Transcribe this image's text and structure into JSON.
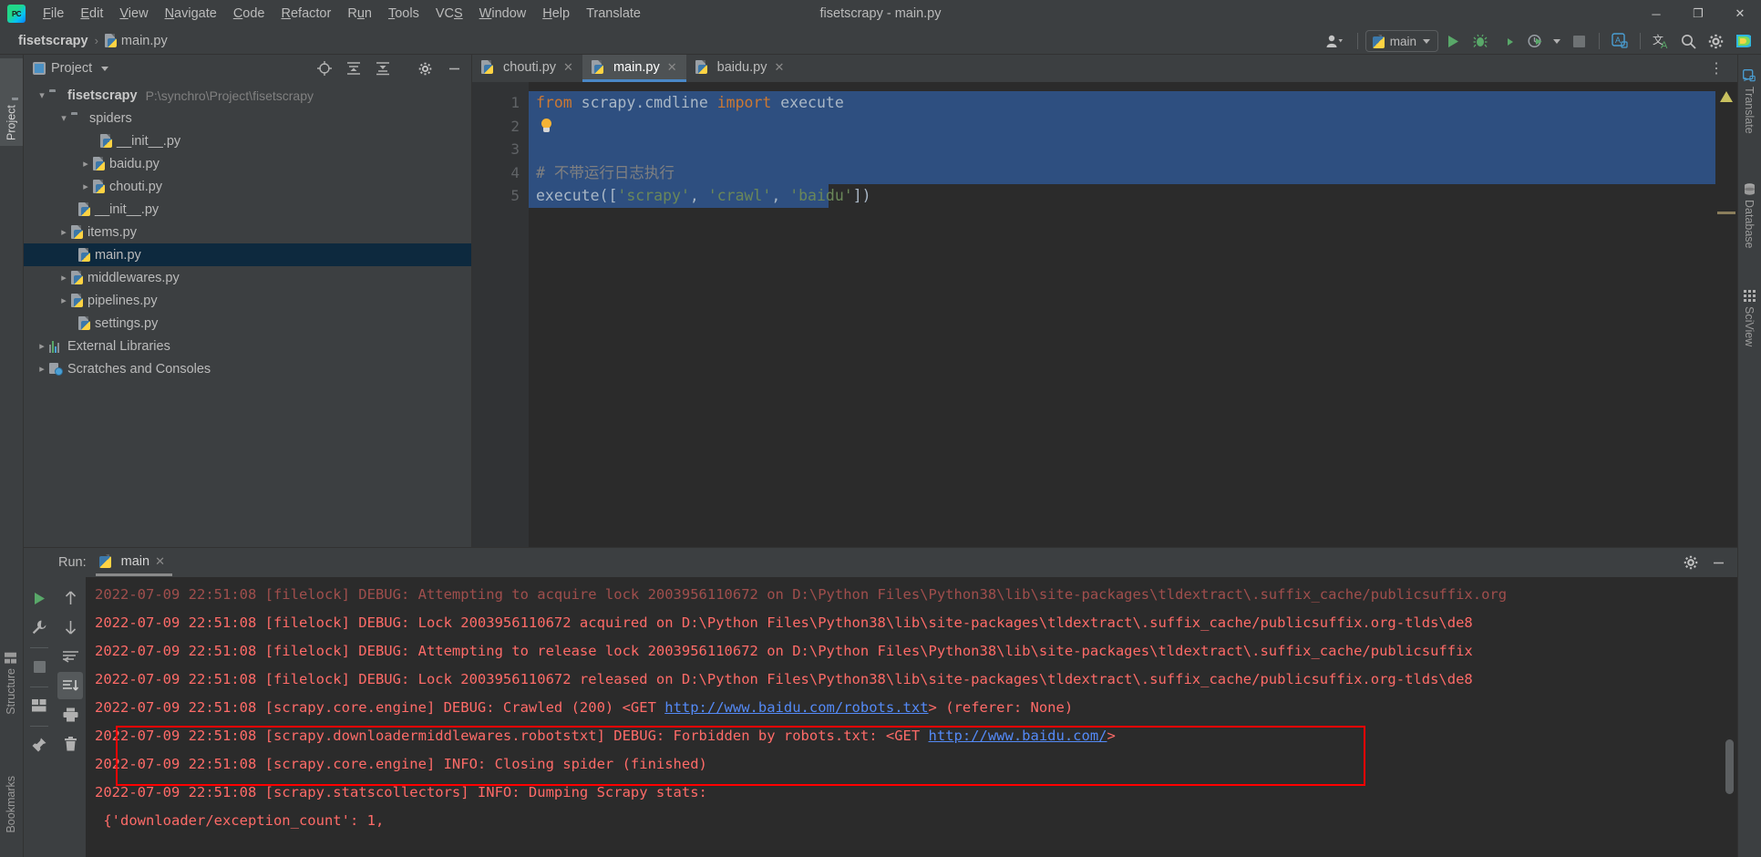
{
  "window": {
    "title": "fisetscrapy - main.py",
    "logo_text": "PC",
    "minimize": "─",
    "maximize": "❐",
    "close": "✕"
  },
  "menubar": {
    "items": [
      {
        "label": "File",
        "mnemonic": "F"
      },
      {
        "label": "Edit",
        "mnemonic": "E"
      },
      {
        "label": "View",
        "mnemonic": "V"
      },
      {
        "label": "Navigate",
        "mnemonic": "N"
      },
      {
        "label": "Code",
        "mnemonic": "C"
      },
      {
        "label": "Refactor",
        "mnemonic": "R"
      },
      {
        "label": "Run",
        "mnemonic": "u"
      },
      {
        "label": "Tools",
        "mnemonic": "T"
      },
      {
        "label": "VCS",
        "mnemonic": "S"
      },
      {
        "label": "Window",
        "mnemonic": "W"
      },
      {
        "label": "Help",
        "mnemonic": "H"
      },
      {
        "label": "Translate",
        "mnemonic": ""
      }
    ]
  },
  "breadcrumb": {
    "project": "fisetscrapy",
    "separator": "›",
    "file": "main.py"
  },
  "navbar_right": {
    "account_icon": "user-avatar-icon",
    "run_config_name": "main",
    "run_config_icon": "python-icon",
    "buttons": [
      {
        "name": "run-button",
        "glyph": "run"
      },
      {
        "name": "debug-button",
        "glyph": "debug"
      },
      {
        "name": "run-with-coverage-button",
        "glyph": "coverage"
      },
      {
        "name": "profile-button",
        "glyph": "profile"
      },
      {
        "name": "stop-button",
        "glyph": "stop"
      },
      {
        "name": "translate-panel-button",
        "glyph": "translate-box"
      },
      {
        "name": "translate-text-button",
        "glyph": "translate-chars"
      },
      {
        "name": "search-everywhere-button",
        "glyph": "search"
      },
      {
        "name": "settings-button",
        "glyph": "gear"
      },
      {
        "name": "plugin-button",
        "glyph": "rainbow"
      }
    ]
  },
  "left_strip": {
    "tabs": [
      {
        "label": "Project",
        "icon": "folder-icon",
        "active": true
      },
      {
        "label": "Structure",
        "icon": "structure-icon",
        "active": false
      },
      {
        "label": "Bookmarks",
        "icon": "bookmark-icon",
        "active": false
      }
    ]
  },
  "right_strip": {
    "tabs": [
      {
        "label": "Translate",
        "icon": "translate-icon"
      },
      {
        "label": "Database",
        "icon": "database-icon"
      },
      {
        "label": "SciView",
        "icon": "sciview-icon"
      }
    ]
  },
  "project_panel": {
    "title": "Project",
    "toolbar": [
      {
        "name": "select-opened-file-button",
        "glyph": "target"
      },
      {
        "name": "expand-all-button",
        "glyph": "expand"
      },
      {
        "name": "collapse-all-button",
        "glyph": "collapse"
      },
      {
        "name": "settings-button",
        "glyph": "gear"
      },
      {
        "name": "hide-button",
        "glyph": "minus"
      }
    ],
    "tree": [
      {
        "label": "fisetscrapy",
        "hint": "P:\\synchro\\Project\\fisetscrapy",
        "indent": 0,
        "arrow": "down",
        "icon": "folder-root-icon",
        "bold": true,
        "selected": false
      },
      {
        "label": "spiders",
        "hint": "",
        "indent": 1,
        "arrow": "down",
        "icon": "folder-source-icon",
        "bold": false,
        "selected": false
      },
      {
        "label": "__init__.py",
        "hint": "",
        "indent": 3,
        "arrow": "",
        "icon": "python-file-icon",
        "bold": false,
        "selected": false
      },
      {
        "label": "baidu.py",
        "hint": "",
        "indent": 2,
        "arrow": "right",
        "icon": "python-file-icon",
        "bold": false,
        "selected": false
      },
      {
        "label": "chouti.py",
        "hint": "",
        "indent": 2,
        "arrow": "right",
        "icon": "python-file-icon",
        "bold": false,
        "selected": false
      },
      {
        "label": "__init__.py",
        "hint": "",
        "indent": 2,
        "arrow": "",
        "icon": "python-file-icon",
        "bold": false,
        "selected": false
      },
      {
        "label": "items.py",
        "hint": "",
        "indent": 1,
        "arrow": "right",
        "icon": "python-file-icon",
        "bold": false,
        "selected": false
      },
      {
        "label": "main.py",
        "hint": "",
        "indent": 2,
        "arrow": "",
        "icon": "python-file-icon",
        "bold": false,
        "selected": true
      },
      {
        "label": "middlewares.py",
        "hint": "",
        "indent": 1,
        "arrow": "right",
        "icon": "python-file-icon",
        "bold": false,
        "selected": false
      },
      {
        "label": "pipelines.py",
        "hint": "",
        "indent": 1,
        "arrow": "right",
        "icon": "python-file-icon",
        "bold": false,
        "selected": false
      },
      {
        "label": "settings.py",
        "hint": "",
        "indent": 2,
        "arrow": "",
        "icon": "python-file-icon",
        "bold": false,
        "selected": false
      },
      {
        "label": "External Libraries",
        "hint": "",
        "indent": 0,
        "arrow": "right",
        "icon": "library-icon",
        "bold": false,
        "selected": false
      },
      {
        "label": "Scratches and Consoles",
        "hint": "",
        "indent": 0,
        "arrow": "right",
        "icon": "scratch-icon",
        "bold": false,
        "selected": false
      }
    ]
  },
  "editor": {
    "tabs": [
      {
        "label": "chouti.py",
        "active": false,
        "close": "✕"
      },
      {
        "label": "main.py",
        "active": true,
        "close": "✕"
      },
      {
        "label": "baidu.py",
        "active": false,
        "close": "✕"
      }
    ],
    "options_glyph": "⋮",
    "line_numbers": [
      "1",
      "2",
      "3",
      "4",
      "5"
    ],
    "code_lines": [
      {
        "n": 1,
        "selected": true,
        "tokens": [
          {
            "t": "from",
            "c": "kw"
          },
          {
            "t": " scrapy.cmdline ",
            "c": "id"
          },
          {
            "t": "import",
            "c": "kw"
          },
          {
            "t": " execute",
            "c": "id"
          }
        ]
      },
      {
        "n": 2,
        "selected": true,
        "tokens": [],
        "bulb": true
      },
      {
        "n": 3,
        "selected": true,
        "tokens": []
      },
      {
        "n": 4,
        "selected": true,
        "tokens": [
          {
            "t": "# 不带运行日志执行",
            "c": "cmt"
          }
        ]
      },
      {
        "n": 5,
        "selected": true,
        "tokens": [
          {
            "t": "execute([",
            "c": "id"
          },
          {
            "t": "'scrapy'",
            "c": "str"
          },
          {
            "t": ", ",
            "c": "id"
          },
          {
            "t": "'crawl'",
            "c": "str"
          },
          {
            "t": ", ",
            "c": "id"
          },
          {
            "t": "'baidu'",
            "c": "str"
          },
          {
            "t": "])",
            "c": "id"
          }
        ]
      }
    ],
    "inspection_icon": "warning-triangle-icon"
  },
  "run_panel": {
    "label": "Run:",
    "tab_name": "main",
    "tab_icon": "python-icon",
    "tab_close": "✕",
    "header_buttons": [
      {
        "name": "settings-button",
        "glyph": "gear"
      },
      {
        "name": "hide-button",
        "glyph": "minus"
      }
    ],
    "left_tools": [
      {
        "name": "rerun-button",
        "glyph": "run"
      },
      {
        "name": "edit-configuration-button",
        "glyph": "wrench"
      },
      {
        "name": "stop-button",
        "glyph": "stop"
      },
      {
        "name": "layout-button",
        "glyph": "layout"
      },
      {
        "name": "pin-tab-button",
        "glyph": "pin"
      }
    ],
    "right_tools": [
      {
        "name": "up-stack-button",
        "glyph": "arrow-up"
      },
      {
        "name": "down-stack-button",
        "glyph": "arrow-down"
      },
      {
        "name": "soft-wrap-button",
        "glyph": "wrap"
      },
      {
        "name": "scroll-to-end-button",
        "glyph": "scroll-end",
        "active": true
      },
      {
        "name": "print-button",
        "glyph": "printer"
      },
      {
        "name": "clear-all-button",
        "glyph": "trash"
      }
    ],
    "console_lines": [
      {
        "text": "2022-07-09 22:51:08 [filelock] DEBUG: Attempting to acquire lock 2003956110672 on D:\\Python Files\\Python38\\lib\\site-packages\\tldextract\\.suffix_cache/publicsuffix.org",
        "clipped": true,
        "highlight": false
      },
      {
        "text": "2022-07-09 22:51:08 [filelock] DEBUG: Lock 2003956110672 acquired on D:\\Python Files\\Python38\\lib\\site-packages\\tldextract\\.suffix_cache/publicsuffix.org-tlds\\de8",
        "clipped": false,
        "highlight": false
      },
      {
        "text": "2022-07-09 22:51:08 [filelock] DEBUG: Attempting to release lock 2003956110672 on D:\\Python Files\\Python38\\lib\\site-packages\\tldextract\\.suffix_cache/publicsuffix",
        "clipped": false,
        "highlight": false
      },
      {
        "text": "2022-07-09 22:51:08 [filelock] DEBUG: Lock 2003956110672 released on D:\\Python Files\\Python38\\lib\\site-packages\\tldextract\\.suffix_cache/publicsuffix.org-tlds\\de8",
        "clipped": false,
        "highlight": false
      },
      {
        "prefix": "2022-07-09 22:51:08 [scrapy.core.engine] DEBUG: Crawled (200) <GET ",
        "link": "http://www.baidu.com/robots.txt",
        "suffix": "> (referer: None)",
        "highlight": true
      },
      {
        "prefix": "2022-07-09 22:51:08 [scrapy.downloadermiddlewares.robotstxt] DEBUG: Forbidden by robots.txt: <GET ",
        "link": "http://www.baidu.com/",
        "suffix": ">",
        "highlight": true
      },
      {
        "text": "2022-07-09 22:51:08 [scrapy.core.engine] INFO: Closing spider (finished)",
        "clipped": false,
        "highlight": false
      },
      {
        "text": "2022-07-09 22:51:08 [scrapy.statscollectors] INFO: Dumping Scrapy stats:",
        "clipped": false,
        "highlight": false
      },
      {
        "text": " {'downloader/exception_count': 1,",
        "clipped": false,
        "highlight": false
      }
    ],
    "annotation_box_color": "#ff0000"
  },
  "colors": {
    "accent": "#4a88c7",
    "selection": "#2e4f80",
    "console_text": "#ff6b68",
    "link": "#548af7",
    "panel_bg": "#3c3f41",
    "editor_bg": "#2b2b2b",
    "tree_selected": "#0d293e"
  }
}
